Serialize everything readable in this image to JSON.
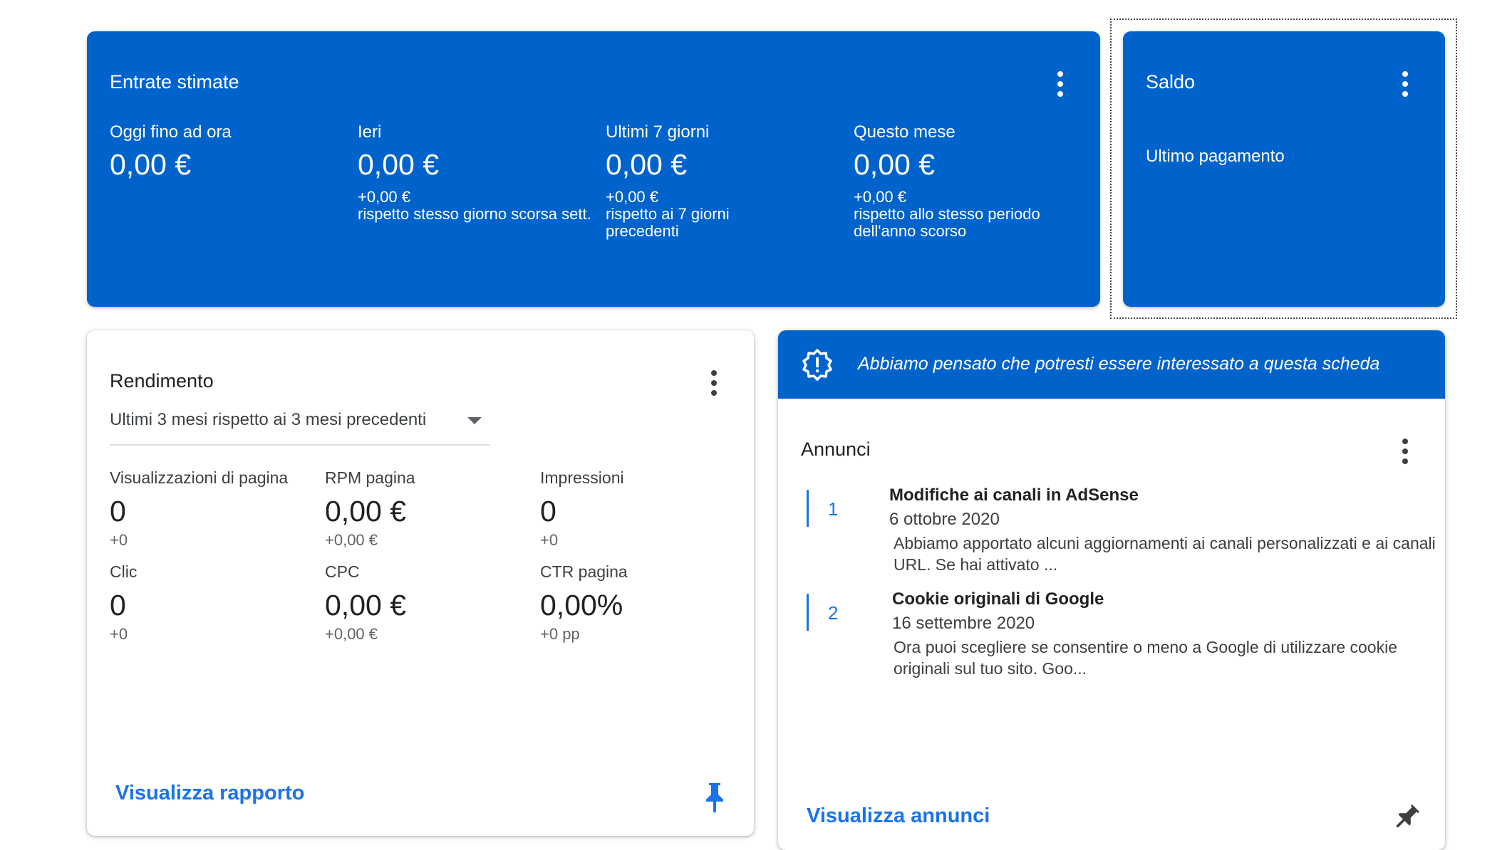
{
  "estimated": {
    "title": "Entrate stimate",
    "periods": [
      {
        "label": "Oggi fino ad ora",
        "value": "0,00 €",
        "delta": "",
        "comparison": ""
      },
      {
        "label": "Ieri",
        "value": "0,00 €",
        "delta": "+0,00 €",
        "comparison": "rispetto stesso giorno scorsa sett."
      },
      {
        "label": "Ultimi 7 giorni",
        "value": "0,00 €",
        "delta": "+0,00 €",
        "comparison": "rispetto ai 7 giorni precedenti"
      },
      {
        "label": "Questo mese",
        "value": "0,00 €",
        "delta": "+0,00 €",
        "comparison": "rispetto allo stesso periodo dell'anno scorso"
      }
    ]
  },
  "balance": {
    "title": "Saldo",
    "last_payment_label": "Ultimo pagamento"
  },
  "performance": {
    "title": "Rendimento",
    "range_selector": "Ultimi 3 mesi rispetto ai 3 mesi precedenti",
    "metrics": [
      {
        "label": "Visualizzazioni di pagina",
        "value": "0",
        "delta": "+0"
      },
      {
        "label": "RPM pagina",
        "value": "0,00 €",
        "delta": "+0,00 €"
      },
      {
        "label": "Impressioni",
        "value": "0",
        "delta": "+0"
      },
      {
        "label": "Clic",
        "value": "0",
        "delta": "+0"
      },
      {
        "label": "CPC",
        "value": "0,00 €",
        "delta": "+0,00 €"
      },
      {
        "label": "CTR pagina",
        "value": "0,00%",
        "delta": "+0 pp"
      }
    ],
    "link": "Visualizza rapporto"
  },
  "suggestion_banner": {
    "text": "Abbiamo pensato che potresti essere interessato a questa scheda",
    "icon": "alert-badge-icon"
  },
  "announcements": {
    "title": "Annunci",
    "items": [
      {
        "number": "1",
        "title": "Modifiche ai canali in AdSense",
        "date": "6 ottobre 2020",
        "body": "Abbiamo apportato alcuni aggiornamenti ai canali personalizzati e ai canali URL. Se hai attivato ..."
      },
      {
        "number": "2",
        "title": "Cookie originali di Google",
        "date": "16 settembre 2020",
        "body": "Ora puoi scegliere se consentire o meno a Google di utilizzare cookie originali sul tuo sito. Goo..."
      }
    ],
    "link": "Visualizza annunci"
  },
  "colors": {
    "card_blue": "#0063cc",
    "link_blue": "#1a73e8"
  }
}
